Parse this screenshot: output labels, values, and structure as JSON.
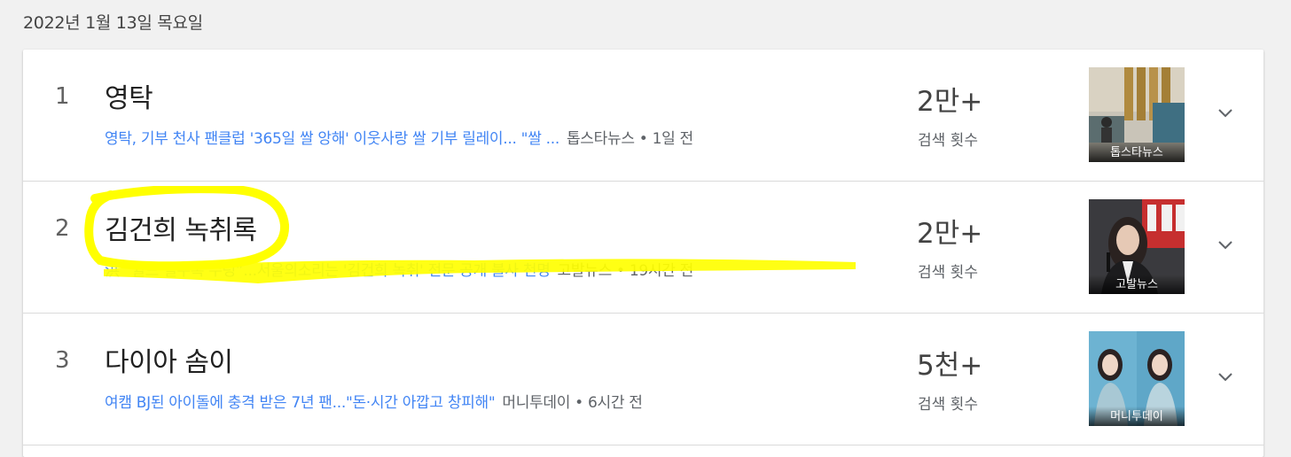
{
  "date": "2022년 1월 13일 목요일",
  "search_count_label": "검색 횟수",
  "items": [
    {
      "rank": "1",
      "title": "영탁",
      "snippet": "영탁, 기부 천사 팬클럽 '365일 쌀 앙해' 이웃사랑 쌀 기부 릴레이... \"쌀 ...",
      "source": "톱스타뉴스 • 1일 전",
      "count": "2만+",
      "thumb_caption": "톱스타뉴스"
    },
    {
      "rank": "2",
      "title": "김건희 녹취록",
      "snippet": "洪 “쉴드 칠수록 수렁”...서울의소리는 '김건희 녹취' 전문 공개 불사 천명",
      "source": "고발뉴스 • 19시간 전",
      "count": "2만+",
      "thumb_caption": "고발뉴스"
    },
    {
      "rank": "3",
      "title": "다이아 솜이",
      "snippet": "여캠 BJ된 아이돌에 충격 받은 7년 팬...\"돈·시간 아깝고 창피해\"",
      "source": "머니투데이 • 6시간 전",
      "count": "5천+",
      "thumb_caption": "머니투데이"
    }
  ],
  "colors": {
    "link": "#4285f4",
    "highlight": "#ffff00",
    "background": "#f1f1f1"
  },
  "icons": [
    "chevron-down-icon"
  ]
}
